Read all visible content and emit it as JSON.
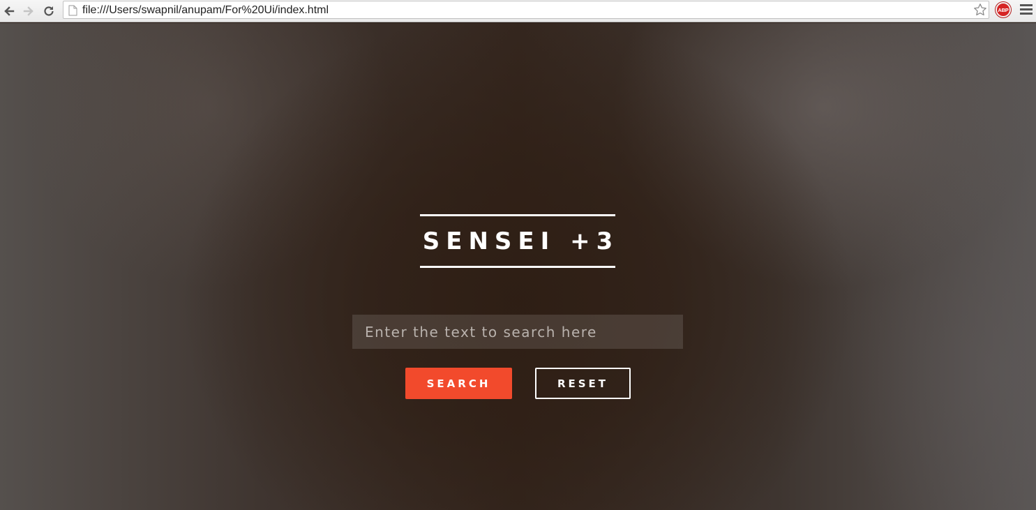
{
  "browser": {
    "url": "file:///Users/swapnil/anupam/For%20Ui/index.html",
    "extension_label": "ABP",
    "icons": {
      "back": "back-arrow-icon",
      "forward": "forward-arrow-icon",
      "reload": "reload-icon",
      "page": "page-icon",
      "bookmark": "star-icon",
      "adblock": "adblock-icon",
      "menu": "hamburger-menu-icon"
    }
  },
  "page": {
    "title": "SENSEI +3",
    "search": {
      "value": "",
      "placeholder": "Enter the text to search here"
    },
    "buttons": {
      "search_label": "SEARCH",
      "reset_label": "RESET"
    },
    "colors": {
      "accent": "#f24a2c",
      "text": "#ffffff"
    }
  }
}
